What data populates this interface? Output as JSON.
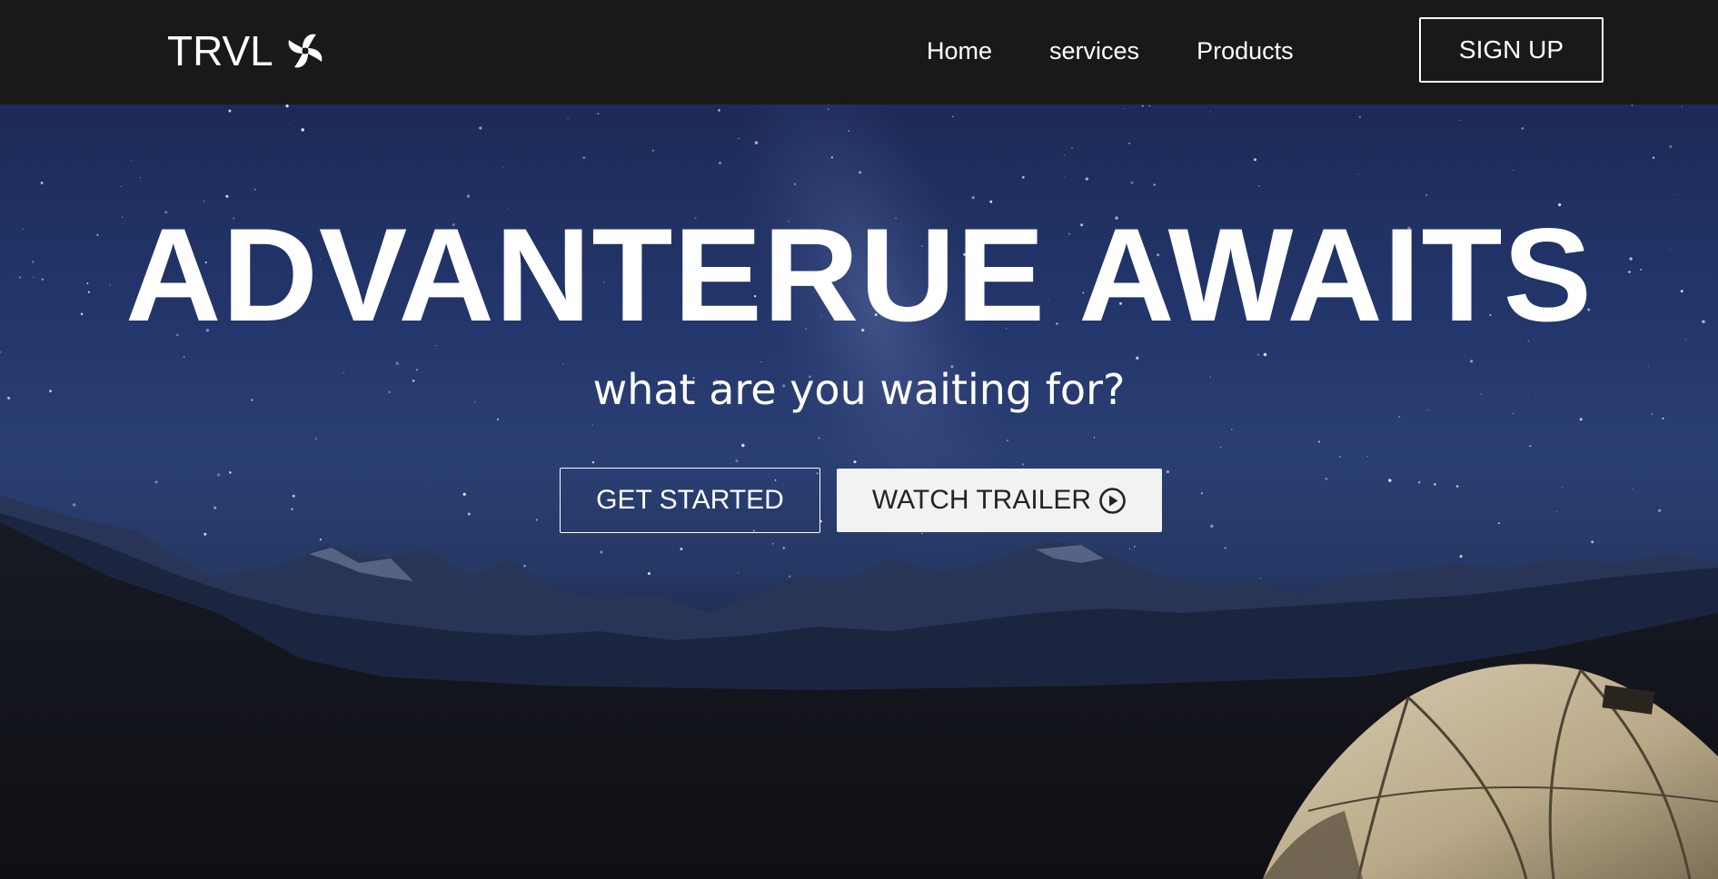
{
  "nav": {
    "logo_text": "TRVL",
    "logo_icon": "pinwheel-icon",
    "links": [
      {
        "label": "Home"
      },
      {
        "label": "services"
      },
      {
        "label": "Products"
      }
    ],
    "signup_label": "SIGN UP"
  },
  "hero": {
    "title": "ADVANTERUE AWAITS",
    "subtitle": "what are you waiting for?",
    "get_started_label": "GET STARTED",
    "watch_trailer_label": "WATCH TRAILER",
    "watch_trailer_icon": "play-circle-icon",
    "background": "night-sky-mountains-tent"
  },
  "colors": {
    "navbar_bg": "#1a1818",
    "text": "#ffffff",
    "secondary_button_bg": "#f2f2f2",
    "secondary_button_text": "#242424",
    "sky_top": "#1d2a56",
    "ground": "#0f1014"
  }
}
